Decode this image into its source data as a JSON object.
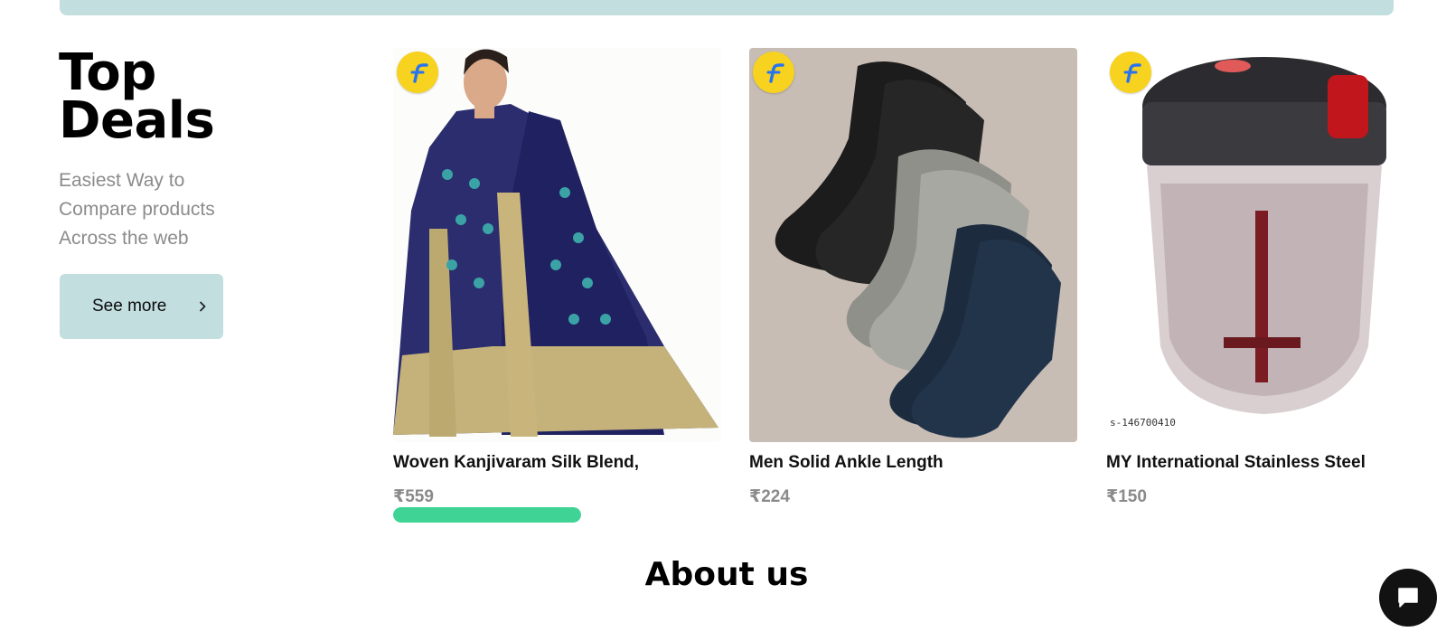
{
  "hero": {
    "title_line1": "Top",
    "title_line2": "Deals",
    "subtitle_lines": [
      "Easiest Way to",
      "Compare products",
      "Across the web"
    ],
    "see_more_label": "See more"
  },
  "products": [
    {
      "name": "Woven Kanjivaram Silk Blend,",
      "price": "₹559",
      "progress": 1.0
    },
    {
      "name": "Men Solid Ankle Length",
      "price": "₹224"
    },
    {
      "name": "MY International Stainless Steel",
      "price": "₹150",
      "image_code": "s-146700410"
    }
  ],
  "about_title": "About us",
  "icons": {
    "badge": "flipkart-logo-icon",
    "chat": "chat-bubble-icon",
    "see_more": "chevron-right-icon"
  },
  "colors": {
    "accent": "#c2dedf",
    "progress": "#3fd496",
    "badge": "#f7d21f"
  }
}
